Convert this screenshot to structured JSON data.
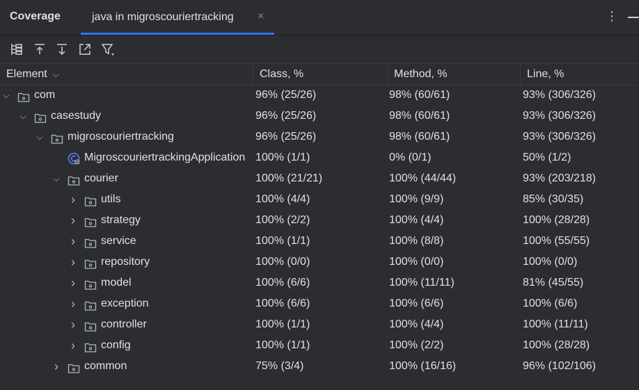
{
  "header": {
    "title": "Coverage",
    "tab_label": "java in migroscouriertracking",
    "tab_close": "×",
    "more_icon": "⋮"
  },
  "toolbar": {
    "buttons": [
      {
        "icon": "flatten-packages-icon"
      },
      {
        "icon": "export-up-icon"
      },
      {
        "icon": "import-down-icon"
      },
      {
        "icon": "open-external-icon"
      },
      {
        "icon": "filter-icon"
      }
    ]
  },
  "columns": {
    "element": "Element",
    "class": "Class, %",
    "method": "Method, %",
    "line": "Line, %"
  },
  "rows": [
    {
      "name": "com",
      "type": "package",
      "expanded": true,
      "class": "96% (25/26)",
      "method": "98% (60/61)",
      "line": "93% (306/326)"
    },
    {
      "name": "casestudy",
      "type": "package",
      "expanded": true,
      "class": "96% (25/26)",
      "method": "98% (60/61)",
      "line": "93% (306/326)"
    },
    {
      "name": "migroscouriertracking",
      "type": "package",
      "expanded": true,
      "class": "96% (25/26)",
      "method": "98% (60/61)",
      "line": "93% (306/326)"
    },
    {
      "name": "MigroscouriertrackingApplication",
      "type": "class",
      "expanded": null,
      "class": "100% (1/1)",
      "method": "0% (0/1)",
      "line": "50% (1/2)"
    },
    {
      "name": "courier",
      "type": "package",
      "expanded": true,
      "class": "100% (21/21)",
      "method": "100% (44/44)",
      "line": "93% (203/218)"
    },
    {
      "name": "utils",
      "type": "package",
      "expanded": false,
      "class": "100% (4/4)",
      "method": "100% (9/9)",
      "line": "85% (30/35)"
    },
    {
      "name": "strategy",
      "type": "package",
      "expanded": false,
      "class": "100% (2/2)",
      "method": "100% (4/4)",
      "line": "100% (28/28)"
    },
    {
      "name": "service",
      "type": "package",
      "expanded": false,
      "class": "100% (1/1)",
      "method": "100% (8/8)",
      "line": "100% (55/55)"
    },
    {
      "name": "repository",
      "type": "package",
      "expanded": false,
      "class": "100% (0/0)",
      "method": "100% (0/0)",
      "line": "100% (0/0)"
    },
    {
      "name": "model",
      "type": "package",
      "expanded": false,
      "class": "100% (6/6)",
      "method": "100% (11/11)",
      "line": "81% (45/55)"
    },
    {
      "name": "exception",
      "type": "package",
      "expanded": false,
      "class": "100% (6/6)",
      "method": "100% (6/6)",
      "line": "100% (6/6)"
    },
    {
      "name": "controller",
      "type": "package",
      "expanded": false,
      "class": "100% (1/1)",
      "method": "100% (4/4)",
      "line": "100% (11/11)"
    },
    {
      "name": "config",
      "type": "package",
      "expanded": false,
      "class": "100% (1/1)",
      "method": "100% (2/2)",
      "line": "100% (28/28)"
    },
    {
      "name": "common",
      "type": "package",
      "expanded": false,
      "class": "75% (3/4)",
      "method": "100% (16/16)",
      "line": "96% (102/106)"
    }
  ],
  "colors": {
    "background": "#2b2d30",
    "text": "#dfe1e5",
    "accent": "#3574f0",
    "class_icon": "#548af7"
  }
}
